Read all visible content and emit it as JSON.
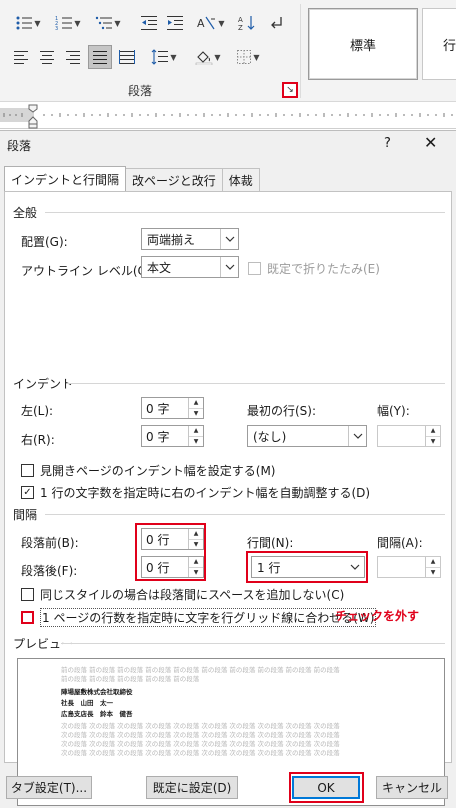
{
  "ribbon": {
    "group_label": "段落",
    "launcher_icon": "dialog-launcher-icon",
    "styles": [
      "標準",
      "行"
    ]
  },
  "dialog": {
    "title": "段落",
    "help": "?",
    "close": "✕",
    "tabs": [
      "インデントと行間隔",
      "改ページと改行",
      "体裁"
    ],
    "general": {
      "section": "全般",
      "alignment_label": "配置(G):",
      "alignment_value": "両端揃え",
      "outline_label": "アウトライン レベル(O):",
      "outline_value": "本文",
      "collapsed_label": "既定で折りたたみ(E)"
    },
    "indent": {
      "section": "インデント",
      "left_label": "左(L):",
      "left_value": "0 字",
      "right_label": "右(R):",
      "right_value": "0 字",
      "first_line_label": "最初の行(S):",
      "first_line_value": "(なし)",
      "width_label": "幅(Y):",
      "width_value": "",
      "mirror_label": "見開きページのインデント幅を設定する(M)",
      "auto_adjust_label": "1 行の文字数を指定時に右のインデント幅を自動調整する(D)"
    },
    "spacing": {
      "section": "間隔",
      "before_label": "段落前(B):",
      "before_value": "0 行",
      "after_label": "段落後(F):",
      "after_value": "0 行",
      "line_spacing_label": "行間(N):",
      "line_spacing_value": "1 行",
      "at_label": "間隔(A):",
      "at_value": "",
      "no_space_same_style_label": "同じスタイルの場合は段落間にスペースを追加しない(C)",
      "snap_to_grid_label": "1 ページの行数を指定時に文字を行グリッド線に合わせる(W)"
    },
    "annotation": "チェックを外す",
    "preview": {
      "section": "プレビュー",
      "prev_para": "前の段落 前の段落 前の段落 前の段落 前の段落 前の段落 前の段落 前の段落 前の段落 前の段落",
      "prev_para2": "前の段落 前の段落 前の段落 前の段落 前の段落",
      "sample1": "陣場屋敷株式会社取締役",
      "sample2": "社長　山田　太一",
      "sample3": "広島支店長　鈴本　健吾",
      "next_para": "次の段落 次の段落 次の段落 次の段落 次の段落 次の段落 次の段落 次の段落 次の段落 次の段落"
    },
    "buttons": {
      "tabs": "タブ設定(T)...",
      "default": "既定に設定(D)",
      "ok": "OK",
      "cancel": "キャンセル"
    }
  },
  "colors": {
    "annotation_red": "#e0001a",
    "dialog_bg": "#f0f0f0",
    "ok_border": "#0078d7"
  }
}
